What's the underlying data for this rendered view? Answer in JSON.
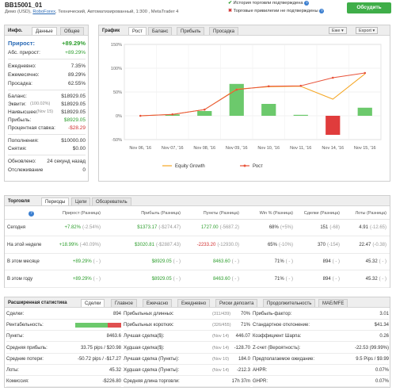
{
  "header": {
    "title": "BB15001_01",
    "subtitle_prefix": "Демо (USD),",
    "broker": "RoboForex",
    "subtitle_suffix": ", Технический, Автоматизированный, 1:300 , MetaTrader 4",
    "history_status": "История торговли подтверждена",
    "privileges_status": "Торговые привилегии не подтверждены",
    "discuss_button": "Обсудить"
  },
  "info": {
    "tabs": [
      "Инфо.",
      "Данные",
      "Общее"
    ],
    "growth_label": "Прирост:",
    "growth_value": "+89.29%",
    "abs_growth_label": "Абс. прирост:",
    "abs_growth_value": "+89.29%",
    "daily_label": "Ежедневно:",
    "daily_value": "7.35%",
    "monthly_label": "Ежемесячно:",
    "monthly_value": "89.29%",
    "drawdown_label": "Просадка:",
    "drawdown_value": "62.55%",
    "balance_label": "Баланс:",
    "balance_value": "$18929.05",
    "equity_label": "Эквити:",
    "equity_pct": "(100.02%)",
    "equity_value": "$18929.05",
    "highest_label": "Наивысшее:",
    "highest_date": "(Nov 15)",
    "highest_value": "$18929.05",
    "profit_label": "Прибыль:",
    "profit_value": "$8929.05",
    "interest_label": "Процентная ставка:",
    "interest_value": "-$28.29",
    "deposits_label": "Пополнения:",
    "deposits_value": "$10000.00",
    "withdrawals_label": "Снятия:",
    "withdrawals_value": "$0.00",
    "updated_label": "Обновлено:",
    "updated_value": "24 секунд назад",
    "tracking_label": "Отслеживание",
    "tracking_value": "0"
  },
  "chart": {
    "tabs": [
      "График",
      "Рост",
      "Баланс",
      "Прибыль",
      "Просадка"
    ],
    "view_button": "Еже",
    "export_button": "Export",
    "legend_equity": "Equity Growth",
    "legend_growth": "Рост",
    "colors": {
      "growth": "#e8533a",
      "equity": "#f5a623",
      "pos_bar": "#6cc96c",
      "neg_bar": "#e03c3c"
    }
  },
  "chart_data": {
    "type": "line",
    "x": [
      "Nov 06, '16",
      "Nov 07, '16",
      "Nov 08, '16",
      "Nov 09, '16",
      "Nov 10, '16",
      "Nov 11, '16",
      "Nov 14, '16",
      "Nov 15, '16"
    ],
    "y_ticks": [
      "150%",
      "100%",
      "50%",
      "0%",
      "-50%"
    ],
    "ylim": [
      -50,
      150
    ],
    "series": [
      {
        "name": "Рост",
        "type": "line",
        "values": [
          0,
          3,
          13,
          55,
          62,
          63,
          80,
          90
        ]
      },
      {
        "name": "Equity Growth",
        "type": "line",
        "values": [
          0,
          3,
          13,
          56,
          61,
          62,
          35,
          88
        ]
      },
      {
        "type": "bar",
        "values": [
          0,
          3,
          10,
          67,
          25,
          2,
          -40,
          17
        ]
      }
    ]
  },
  "trading": {
    "tabs": [
      "Торговля",
      "Периоды",
      "Цели",
      "Обозреватель"
    ],
    "columns": [
      "Прирост (Разница)",
      "Прибыль (Разница)",
      "Пункты (Разница)",
      "Win % (Разница)",
      "Сделки (Разница)",
      "Лоты (Разница)"
    ],
    "rows": [
      {
        "label": "Сегодня",
        "growth": "+7.82%",
        "growth_diff": "(-2.54%)",
        "profit": "$1373.17",
        "profit_diff": "(-$274.47)",
        "pips": "1727.00",
        "pips_diff": "(-5687.2)",
        "win": "68%",
        "win_diff": "(+5%)",
        "trades": "151",
        "trades_diff": "(-68)",
        "lots": "4.91",
        "lots_diff": "(-12.65)"
      },
      {
        "label": "На этой неделе",
        "growth": "+18.99%",
        "growth_diff": "(-40.09%)",
        "profit": "$3020.81",
        "profit_diff": "(-$2887.43)",
        "pips": "-2233.20",
        "pips_diff": "(-12930.0)",
        "win": "65%",
        "win_diff": "(-10%)",
        "trades": "370",
        "trades_diff": "(-154)",
        "lots": "22.47",
        "lots_diff": "(-0.38)"
      },
      {
        "label": "В этом месяце",
        "growth": "+89.29%",
        "growth_diff": "( - )",
        "profit": "$8929.05",
        "profit_diff": "( - )",
        "pips": "8463.60",
        "pips_diff": "( - )",
        "win": "71%",
        "win_diff": "( - )",
        "trades": "894",
        "trades_diff": "( - )",
        "lots": "45.32",
        "lots_diff": "( - )"
      },
      {
        "label": "В этом году",
        "growth": "+89.29%",
        "growth_diff": "( - )",
        "profit": "$8929.05",
        "profit_diff": "( - )",
        "pips": "8463.60",
        "pips_diff": "( - )",
        "win": "71%",
        "win_diff": "( - )",
        "trades": "894",
        "trades_diff": "( - )",
        "lots": "45.32",
        "lots_diff": "( - )"
      }
    ]
  },
  "stats": {
    "tabs": [
      "Расширенная статистика",
      "Сделки",
      "Главное",
      "Ежечасно",
      "Ежедневно",
      "Риски депозита",
      "Продолжительность",
      "MAE/MFE"
    ],
    "col1": [
      {
        "label": "Сделки:",
        "value": "894"
      },
      {
        "label": "Рентабельность:",
        "value": ""
      },
      {
        "label": "Пункты:",
        "value": "8463.6"
      },
      {
        "label": "Средняя прибыль:",
        "value": "33.75 pips / $20.98"
      },
      {
        "label": "Средние потери:",
        "value": "-50.72 pips / -$17.27"
      },
      {
        "label": "Лоты:",
        "value": "45.32"
      },
      {
        "label": "Комиссия:",
        "value": "-$226.80"
      }
    ],
    "col2": [
      {
        "label": "Прибыльных длинных:",
        "note": "(311/439)",
        "value": "70%"
      },
      {
        "label": "Прибыльных коротких:",
        "note": "(326/455)",
        "value": "71%"
      },
      {
        "label": "Лучшая сделка($):",
        "note": "(Nov 14)",
        "value": "446.07"
      },
      {
        "label": "Худшая сделка($):",
        "note": "(Nov 14)",
        "value": "-128.70"
      },
      {
        "label": "Лучшая сделка (Пункты):",
        "note": "(Nov 10)",
        "value": "184.0"
      },
      {
        "label": "Худшая сделка (Пункты):",
        "note": "(Nov 14)",
        "value": "-212.3"
      },
      {
        "label": "Средняя длина торговли:",
        "note": "",
        "value": "17h 37m"
      }
    ],
    "col3": [
      {
        "label": "Прибыль-фактор:",
        "value": "3.01"
      },
      {
        "label": "Стандартное отклонение:",
        "value": "$41.34"
      },
      {
        "label": "Коэффициент Шарпа:",
        "value": "0.26"
      },
      {
        "label": "Z-счет (Вероятность):",
        "value": "-22.53 (99.99%)"
      },
      {
        "label": "Предполагаемое ожидание:",
        "value": "9.5 Pips / $9.99"
      },
      {
        "label": "AHPR:",
        "value": "0.07%"
      },
      {
        "label": "GHPR:",
        "value": "0.07%"
      }
    ],
    "profitability_win_fraction": 0.71
  }
}
